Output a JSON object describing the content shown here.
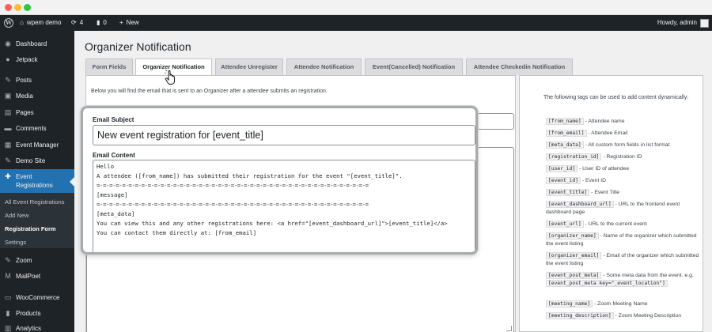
{
  "adminbar": {
    "site_name": "wpem demo",
    "updates_count": "4",
    "comments_count": "0",
    "new_label": "New",
    "howdy": "Howdy, admin"
  },
  "sidebar": {
    "items": [
      {
        "label": "Dashboard",
        "icon": "dashboard-icon"
      },
      {
        "label": "Jetpack",
        "icon": "jetpack-icon"
      },
      {
        "label": "Posts",
        "icon": "pin-icon"
      },
      {
        "label": "Media",
        "icon": "media-icon"
      },
      {
        "label": "Pages",
        "icon": "pages-icon"
      },
      {
        "label": "Comments",
        "icon": "comment-icon"
      },
      {
        "label": "Event Manager",
        "icon": "calendar-icon"
      },
      {
        "label": "Demo Site",
        "icon": "pin-icon"
      },
      {
        "label": "Event Registrations",
        "icon": "registration-icon"
      },
      {
        "label": "Zoom",
        "icon": "pin-icon"
      },
      {
        "label": "MailPoet",
        "icon": "mailpoet-icon"
      },
      {
        "label": "WooCommerce",
        "icon": "woo-icon"
      },
      {
        "label": "Products",
        "icon": "products-icon"
      },
      {
        "label": "Analytics",
        "icon": "analytics-icon"
      }
    ],
    "submenu": [
      "All Event Registrations",
      "Add New",
      "Registration Form",
      "Settings"
    ]
  },
  "page": {
    "title": "Organizer Notification",
    "tabs": [
      "Form Fields",
      "Organizer Notification",
      "Attendee Unregister",
      "Attendee Notification",
      "Event(Cancelled) Notification",
      "Attendee Checkedin Notification"
    ],
    "intro": "Below you will find the email that is sent to an Organizer after a attendee submits an registration."
  },
  "email": {
    "subject_label": "Email Subject",
    "subject_value": "New event registration for [event_title]",
    "content_label": "Email Content",
    "content_lines": [
      "Hello",
      "A attendee ([from_name]) has submitted their registration for the event \"[event_title]\".",
      "=-=-=-=-=-=-=-=-=-=-=-=-=-=-=-=-=-=-=-=-=-=-=-=-=-=-=-=-=-=-=-=-=-=-=-=-=-=-=-=-=-=-=",
      "[message]",
      "=-=-=-=-=-=-=-=-=-=-=-=-=-=-=-=-=-=-=-=-=-=-=-=-=-=-=-=-=-=-=-=-=-=-=-=-=-=-=-=-=-=-=",
      "[meta_data]",
      "You can view this and any other registrations here: <a href=\"[event_dashboard_url]\">[event_title]</a>",
      "You can contact them directly at: [from_email]"
    ]
  },
  "tags": {
    "intro": "The following tags can be used to add content dynamically:",
    "rows": [
      {
        "code": "[from_name]",
        "desc": " - Attendee name"
      },
      {
        "code": "[from_email]",
        "desc": " - Attendee Email"
      },
      {
        "code": "[meta_data]",
        "desc": " - All custom form fields in list format"
      },
      {
        "code": "[registration_id]",
        "desc": " - Registration ID"
      },
      {
        "code": "[user_id]",
        "desc": " - User ID of attendee"
      },
      {
        "code": "[event_id]",
        "desc": " - Event ID"
      },
      {
        "code": "[event_title]",
        "desc": " - Event Title"
      },
      {
        "code": "[event_dashboard_url]",
        "desc": " - URL to the frontend event dashboard page"
      },
      {
        "code": "[event_url]",
        "desc": " - URL to the current event"
      },
      {
        "code": "[organizer_name]",
        "desc": " - Name of the organizer which submitted the event listing"
      },
      {
        "code": "[organizer_email]",
        "desc": " - Email of the organizer which submitted the event listing"
      },
      {
        "code": "[event_post_meta]",
        "desc": " - Some meta data from the event. e.g. ",
        "code2": "[event_post_meta key=\"_event_location\"]"
      },
      {
        "code": "[meeting_name]",
        "desc": " - Zoom Meeting Name"
      },
      {
        "code": "[meeting_description]",
        "desc": " - Zoom Meeting Description"
      }
    ]
  },
  "colors": {
    "adminbar": "#1d2327",
    "accent": "#2271b1",
    "background": "#f0f0f1"
  }
}
